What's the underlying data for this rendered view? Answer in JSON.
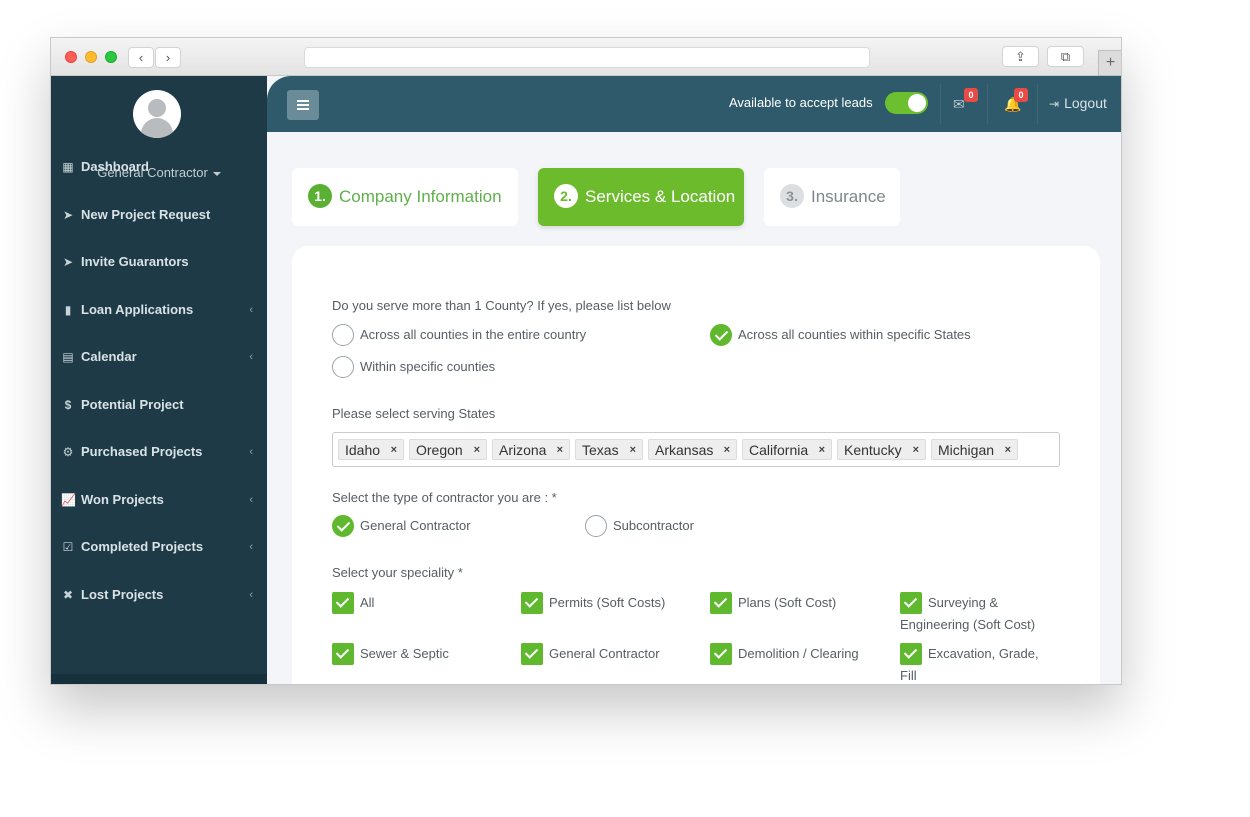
{
  "browser": {
    "back_label": "‹",
    "forward_label": "›",
    "share_label": "⇪",
    "tabs_label": "⧉",
    "new_tab_label": "+"
  },
  "sidebar": {
    "role": "General Contractor",
    "items": [
      {
        "label": "Dashboard",
        "icon": "dashboard-icon",
        "glyph": "▦",
        "has_arrow": false
      },
      {
        "label": "New Project Request",
        "icon": "paper-plane-icon",
        "glyph": "➤",
        "has_arrow": false
      },
      {
        "label": "Invite Guarantors",
        "icon": "paper-plane-icon",
        "glyph": "➤",
        "has_arrow": false
      },
      {
        "label": "Loan Applications",
        "icon": "document-icon",
        "glyph": "▮",
        "has_arrow": true
      },
      {
        "label": "Calendar",
        "icon": "calendar-icon",
        "glyph": "▤",
        "has_arrow": true
      },
      {
        "label": "Potential Project",
        "icon": "dollar-icon",
        "glyph": "$",
        "has_arrow": false
      },
      {
        "label": "Purchased Projects",
        "icon": "gears-icon",
        "glyph": "⚙",
        "has_arrow": true
      },
      {
        "label": "Won Projects",
        "icon": "line-chart-icon",
        "glyph": "📈",
        "has_arrow": true
      },
      {
        "label": "Completed Projects",
        "icon": "check-square-icon",
        "glyph": "☑",
        "has_arrow": true
      },
      {
        "label": "Lost Projects",
        "icon": "times-icon",
        "glyph": "✖",
        "has_arrow": true
      }
    ],
    "arrow_glyph": "‹"
  },
  "topbar": {
    "lead_label": "Available to accept leads",
    "lead_toggle_on": true,
    "mail_count": "0",
    "bell_count": "0",
    "logout_label": "Logout"
  },
  "steps": [
    {
      "num": "1.",
      "label": "Company Information"
    },
    {
      "num": "2.",
      "label": "Services & Location"
    },
    {
      "num": "3.",
      "label": "Insurance"
    }
  ],
  "form": {
    "county_question": "Do you serve more than 1 County? If yes, please list below",
    "county_options": [
      {
        "label": "Across all counties in the entire country",
        "selected": false
      },
      {
        "label": "Across all counties within specific States",
        "selected": true
      },
      {
        "label": "Within specific counties",
        "selected": false
      }
    ],
    "states_label": "Please select serving States",
    "states": [
      "Idaho",
      "Oregon",
      "Arizona",
      "Texas",
      "Arkansas",
      "California",
      "Kentucky",
      "Michigan"
    ],
    "remove_glyph": "×",
    "contractor_label": "Select the type of contractor you are : *",
    "contractor_options": [
      {
        "label": "General Contractor",
        "selected": true
      },
      {
        "label": "Subcontractor",
        "selected": false
      }
    ],
    "speciality_label": "Select your speciality *",
    "specialities": [
      {
        "lines": [
          "All"
        ],
        "checked": true
      },
      {
        "lines": [
          "Permits (Soft Costs)"
        ],
        "checked": true
      },
      {
        "lines": [
          "Plans (Soft Cost)"
        ],
        "checked": true
      },
      {
        "lines": [
          "Surveying &",
          "Engineering (Soft Cost)"
        ],
        "checked": true
      },
      {
        "lines": [
          "Sewer & Septic"
        ],
        "checked": true
      },
      {
        "lines": [
          "General Contractor"
        ],
        "checked": true
      },
      {
        "lines": [
          "Demolition / Clearing"
        ],
        "checked": true
      },
      {
        "lines": [
          "Excavation, Grade,",
          "Fill"
        ],
        "checked": true
      }
    ]
  }
}
